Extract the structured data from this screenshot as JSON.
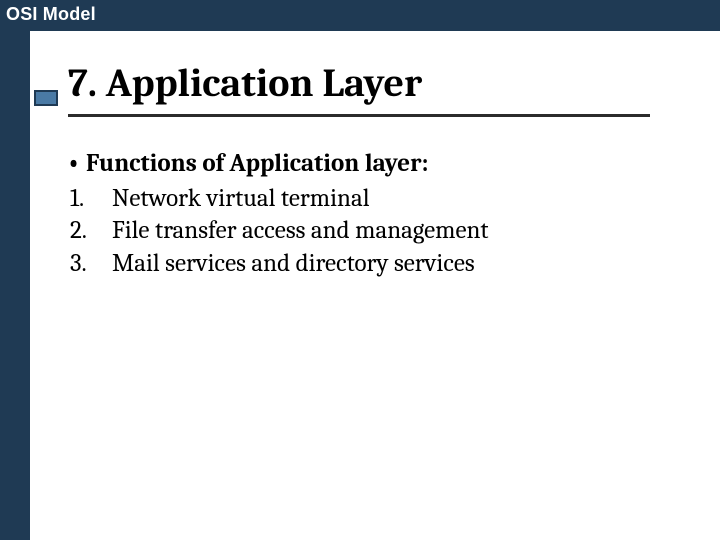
{
  "header": {
    "title": "OSI Model"
  },
  "slide": {
    "title": "7. Application Layer",
    "subheading_bullet": "•",
    "subheading": "Functions of Application layer:",
    "items": [
      {
        "num": "1.",
        "text": "Network virtual terminal"
      },
      {
        "num": "2.",
        "text": "File transfer access and management"
      },
      {
        "num": "3.",
        "text": "Mail services and directory services"
      }
    ]
  }
}
